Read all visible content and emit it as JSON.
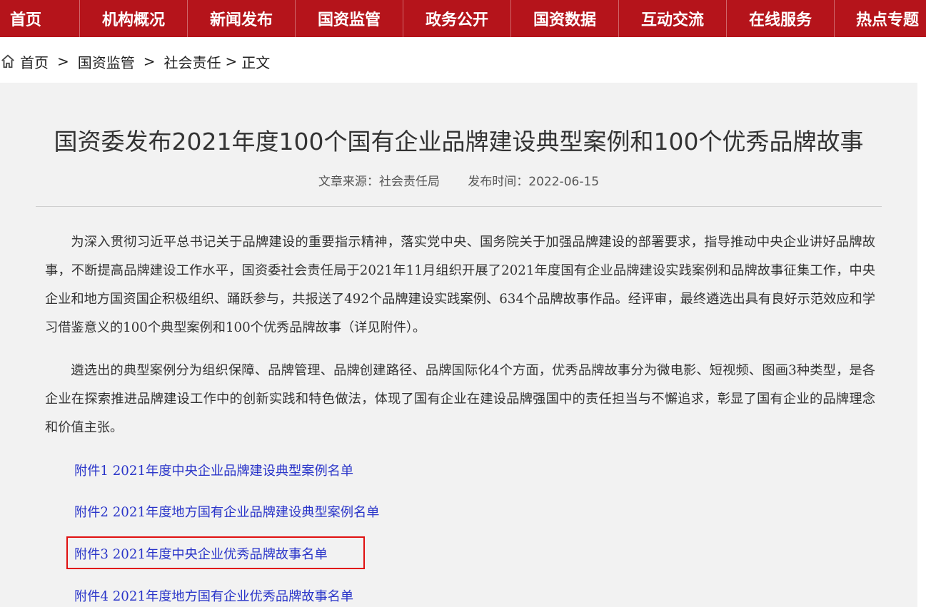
{
  "nav": {
    "items": [
      "首页",
      "机构概况",
      "新闻发布",
      "国资监管",
      "政务公开",
      "国资数据",
      "互动交流",
      "在线服务",
      "热点专题"
    ]
  },
  "breadcrumb": {
    "home": "首页",
    "sep": ">",
    "level2": "国资监管",
    "level3": "社会责任",
    "current": "正文"
  },
  "article": {
    "title": "国资委发布2021年度100个国有企业品牌建设典型案例和100个优秀品牌故事",
    "source": "文章来源：社会责任局",
    "date": "发布时间：2022-06-15",
    "para1": "为深入贯彻习近平总书记关于品牌建设的重要指示精神，落实党中央、国务院关于加强品牌建设的部署要求，指导推动中央企业讲好品牌故事，不断提高品牌建设工作水平，国资委社会责任局于2021年11月组织开展了2021年度国有企业品牌建设实践案例和品牌故事征集工作，中央企业和地方国资国企积极组织、踊跃参与，共报送了492个品牌建设实践案例、634个品牌故事作品。经评审，最终遴选出具有良好示范效应和学习借鉴意义的100个典型案例和100个优秀品牌故事（详见附件）。",
    "para2": "遴选出的典型案例分为组织保障、品牌管理、品牌创建路径、品牌国际化4个方面，优秀品牌故事分为微电影、短视频、图画3种类型，是各企业在探索推进品牌建设工作中的创新实践和特色做法，体现了国有企业在建设品牌强国中的责任担当与不懈追求，彰显了国有企业的品牌理念和价值主张。",
    "attachments": [
      "附件1 2021年度中央企业品牌建设典型案例名单",
      "附件2 2021年度地方国有企业品牌建设典型案例名单",
      "附件3 2021年度中央企业优秀品牌故事名单",
      "附件4 2021年度地方国有企业优秀品牌故事名单"
    ]
  },
  "colors": {
    "nav_bg": "#b5141b",
    "link": "#2a35c9",
    "highlight": "#e01010",
    "content_bg": "#f2f2f2"
  },
  "icons": {
    "breadcrumb_home": "home-icon"
  }
}
